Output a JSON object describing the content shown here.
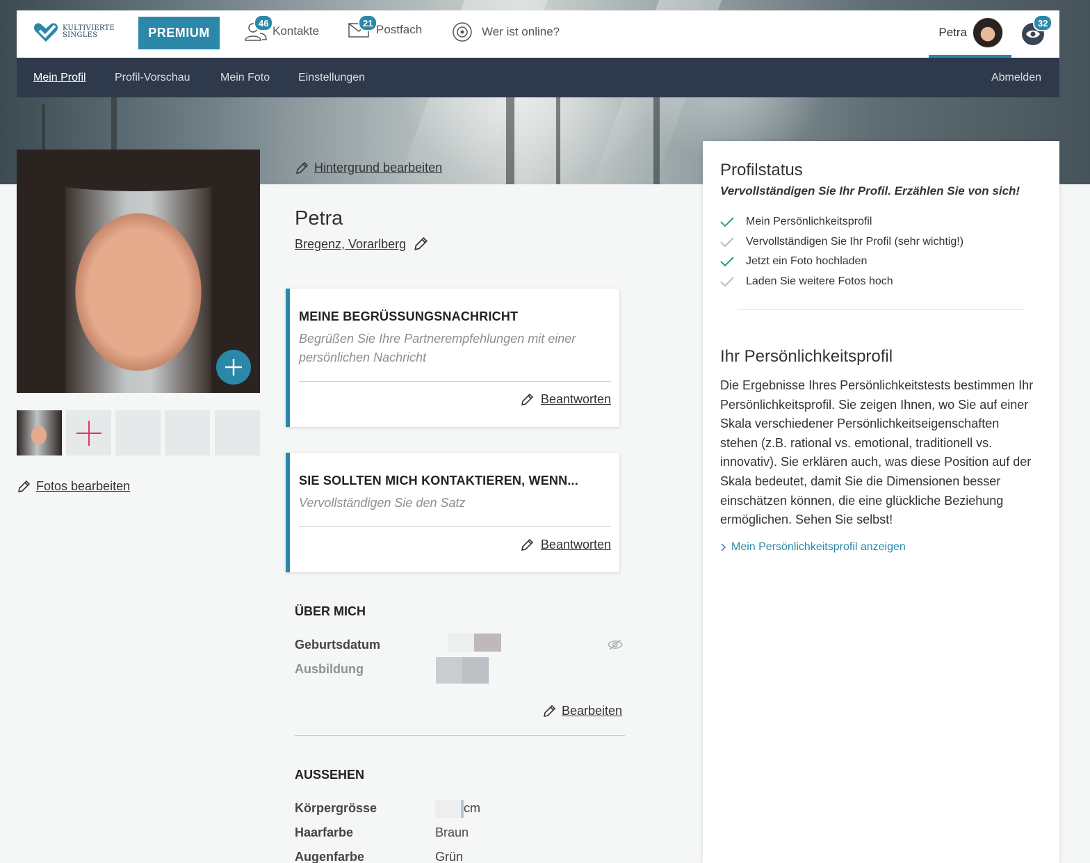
{
  "brand": {
    "logo_line1": "KULTIVIERTE",
    "logo_line2": "SINGLES",
    "accent": "#2b88a9",
    "nav_dark": "#2e3a4b"
  },
  "topbar": {
    "premium_label": "PREMIUM",
    "contacts": {
      "label": "Kontakte",
      "count": "46"
    },
    "inbox": {
      "label": "Postfach",
      "count": "21"
    },
    "online": {
      "label": "Wer ist online?"
    },
    "user_name": "Petra",
    "visitors_count": "32"
  },
  "subnav": {
    "items": [
      "Mein Profil",
      "Profil-Vorschau",
      "Mein Foto",
      "Einstellungen"
    ],
    "logout": "Abmelden"
  },
  "left": {
    "edit_background": "Hintergrund bearbeiten",
    "edit_photos": "Fotos bearbeiten"
  },
  "profile": {
    "name": "Petra",
    "location": "Bregenz, Vorarlberg"
  },
  "greeting_card": {
    "title": "MEINE BEGRÜSSUNGSNACHRICHT",
    "hint": "Begrüßen Sie Ihre Partnerempfehlungen mit einer persönlichen Nachricht",
    "answer": "Beantworten"
  },
  "contact_card": {
    "title": "SIE SOLLTEN MICH KONTAKTIEREN, WENN...",
    "hint": "Vervollständigen Sie den Satz",
    "answer": "Beantworten"
  },
  "about": {
    "title": "ÜBER MICH",
    "rows": [
      {
        "label": "Geburtsdatum"
      },
      {
        "label": "Ausbildung"
      }
    ],
    "edit": "Bearbeiten"
  },
  "appearance": {
    "title": "AUSSEHEN",
    "rows": [
      {
        "label": "Körpergrösse",
        "value": "cm"
      },
      {
        "label": "Haarfarbe",
        "value": "Braun"
      },
      {
        "label": "Augenfarbe",
        "value": "Grün"
      }
    ]
  },
  "status": {
    "title": "Profilstatus",
    "subtitle": "Vervollständigen Sie Ihr Profil. Erzählen Sie von sich!",
    "items": [
      {
        "label": "Mein Persönlichkeitsprofil",
        "done": true
      },
      {
        "label": "Vervollständigen Sie Ihr Profil (sehr wichtig!)",
        "done": false
      },
      {
        "label": "Jetzt ein Foto hochladen",
        "done": true
      },
      {
        "label": "Laden Sie weitere Fotos hoch",
        "done": false
      }
    ]
  },
  "personality": {
    "title": "Ihr Persönlichkeitsprofil",
    "text": "Die Ergebnisse Ihres Persönlichkeitstests bestimmen Ihr Persönlichkeitsprofil. Sie zeigen Ihnen, wo Sie auf einer Skala verschiedener Persönlichkeitseigenschaften stehen (z.B. rational vs. emotional, traditionell vs. innovativ). Sie erklären auch, was diese Position auf der Skala bedeutet, damit Sie die Dimensionen besser einschätzen können, die eine glückliche Beziehung ermöglichen. Sehen Sie selbst!",
    "link": "Mein Persönlichkeitsprofil anzeigen"
  }
}
